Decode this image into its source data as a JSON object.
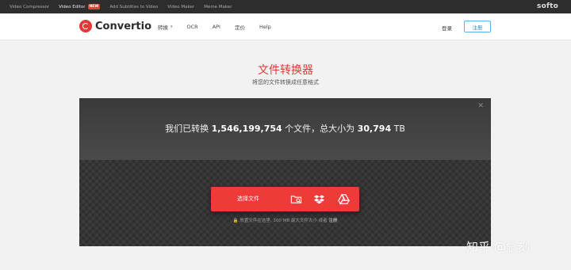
{
  "topbar": {
    "links": [
      {
        "label": "Video Compressor"
      },
      {
        "label": "Video Editor"
      },
      {
        "label": "Add Subtitles to Video"
      },
      {
        "label": "Video Maker"
      },
      {
        "label": "Meme Maker"
      }
    ],
    "new_badge": "NEW",
    "brand": "softo"
  },
  "nav": {
    "logo_text": "Convertio",
    "menu": [
      "转换",
      "OCR",
      "API",
      "定价",
      "Help"
    ],
    "login": "登录",
    "register": "注册"
  },
  "heading": {
    "title": "文件转换器",
    "subtitle": "将您的文件转换成任意格式"
  },
  "converter": {
    "stats_prefix": "我们已转换",
    "files_count": "1,546,199,754",
    "stats_middle": "个文件，总大小为",
    "total_size": "30,794",
    "size_unit": "TB",
    "choose_label": "选择文件",
    "note_text": "放置文件在这里. 100 MB 最大文件大小 或者",
    "note_link": "注册",
    "accent_color": "#ef3a3a"
  },
  "watermark": "知乎 @氩刻"
}
